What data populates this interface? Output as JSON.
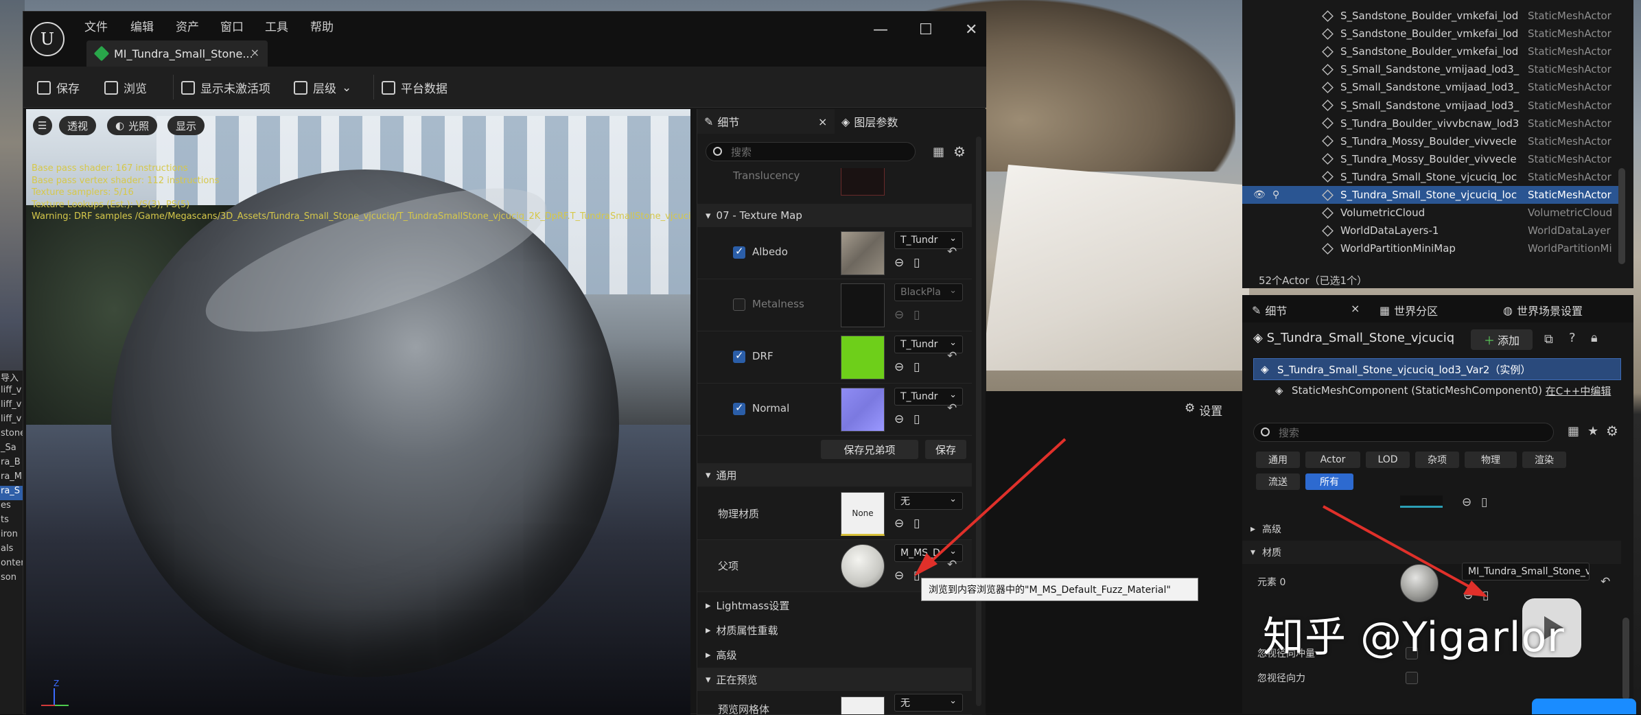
{
  "scene": {
    "left_partial_items": [
      "导入",
      "liff_v",
      "liff_v",
      "liff_v",
      "stone",
      "_Sa",
      "ra_B",
      "ra_M",
      "ra_S",
      "es",
      "ts",
      "iron",
      "als",
      "onten",
      "son"
    ],
    "left_selected_index": 8
  },
  "window": {
    "menu": [
      "文件",
      "编辑",
      "资产",
      "窗口",
      "工具",
      "帮助"
    ],
    "tab_title": "MI_Tundra_Small_Stone...",
    "tab_close": "×",
    "controls": {
      "minimize": "—",
      "maximize": "☐",
      "close": "✕"
    },
    "toolbar": {
      "save": "保存",
      "browse": "浏览",
      "show_inactive": "显示未激活项",
      "hierarchy": "层级",
      "platform": "平台数据"
    }
  },
  "viewport": {
    "buttons": {
      "menu": "☰",
      "perspective": "透视",
      "lit": "光照",
      "show": "显示"
    },
    "stats": [
      "Base pass shader: 167 instructions",
      "Base pass vertex shader: 112 instructions",
      "Texture samplers: 5/16",
      "Texture Lookups (Est.): VS(3), PS(5)",
      "Warning: DRF samples /Game/Megascans/3D_Assets/Tundra_Small_Stone_vjcuciq/T_TundraSmallStone_vjcuciq_2K_DpRF.T_TundraSmallStone_vjcuciq"
    ],
    "gizmo": {
      "x": "X",
      "y": "Y",
      "z": "Z"
    }
  },
  "details": {
    "tab_details": "细节",
    "tab_close": "×",
    "tab_layers": "图层参数",
    "search_placeholder": "搜索",
    "partial_label": "Translucency",
    "section_texture": "07 - Texture Map",
    "params": [
      {
        "label": "Albedo",
        "checked": true,
        "value": "T_Tundr",
        "color": "#8c8478"
      },
      {
        "label": "Metalness",
        "checked": false,
        "value": "BlackPla",
        "color": "#121212"
      },
      {
        "label": "DRF",
        "checked": true,
        "value": "T_Tundr",
        "color": "#6ecf1a"
      },
      {
        "label": "Normal",
        "checked": true,
        "value": "T_Tundr",
        "color": "#8a88f0"
      }
    ],
    "save_siblings": "保存兄弟项",
    "save_partial": "保存",
    "section_general": "通用",
    "phys_mat_label": "物理材质",
    "phys_mat_thumb": "None",
    "phys_mat_value": "无",
    "parent_label": "父项",
    "parent_value": "M_MS_D",
    "lightmass": "Lightmass设置",
    "mat_override": "材质属性重载",
    "advanced": "高级",
    "previewing": "正在预览",
    "preview_mesh_label": "预览网格体",
    "preview_mesh_thumb": "None",
    "preview_mesh_value": "无",
    "tooltip": "浏览到内容浏览器中的\"M_MS_Default_Fuzz_Material\"",
    "settings": "设置"
  },
  "outliner": {
    "rows": [
      {
        "name": "S_Sandstone_Boulder_vmkefai_lod",
        "type": "StaticMeshActor"
      },
      {
        "name": "S_Sandstone_Boulder_vmkefai_lod",
        "type": "StaticMeshActor"
      },
      {
        "name": "S_Sandstone_Boulder_vmkefai_lod",
        "type": "StaticMeshActor"
      },
      {
        "name": "S_Small_Sandstone_vmijaad_lod3_",
        "type": "StaticMeshActor"
      },
      {
        "name": "S_Small_Sandstone_vmijaad_lod3_",
        "type": "StaticMeshActor"
      },
      {
        "name": "S_Small_Sandstone_vmijaad_lod3_",
        "type": "StaticMeshActor"
      },
      {
        "name": "S_Tundra_Boulder_vivvbcnaw_lod3",
        "type": "StaticMeshActor"
      },
      {
        "name": "S_Tundra_Mossy_Boulder_vivvecle",
        "type": "StaticMeshActor"
      },
      {
        "name": "S_Tundra_Mossy_Boulder_vivvecle",
        "type": "StaticMeshActor"
      },
      {
        "name": "S_Tundra_Small_Stone_vjcuciq_loc",
        "type": "StaticMeshActor"
      },
      {
        "name": "S_Tundra_Small_Stone_vjcuciq_loc",
        "type": "StaticMeshActor"
      },
      {
        "name": "VolumetricCloud",
        "type": "VolumetricCloud"
      },
      {
        "name": "WorldDataLayers-1",
        "type": "WorldDataLayer"
      },
      {
        "name": "WorldPartitionMiniMap",
        "type": "WorldPartitionMi"
      }
    ],
    "selected_index": 10,
    "count": "52个Actor（已选1个）"
  },
  "rdetails": {
    "tab_details": "细节",
    "tab_close": "×",
    "tab_world": "世界分区",
    "tab_settings": "世界场景设置",
    "object_name": "S_Tundra_Small_Stone_vjcuciq",
    "add": "添加",
    "instance": "S_Tundra_Small_Stone_vjcuciq_lod3_Var2（实例）",
    "component": "StaticMeshComponent (StaticMeshComponent0)",
    "component_link": "在C++中编辑",
    "search_placeholder": "搜索",
    "filters": [
      "通用",
      "Actor",
      "LOD",
      "杂项",
      "物理",
      "渲染",
      "流送",
      "所有"
    ],
    "active_filter": "所有",
    "advanced": "高级",
    "materials": "材质",
    "element_label": "元素 0",
    "element_value": "MI_Tundra_Small_Stone_vjc",
    "ignore_impulse": "忽视径向冲量",
    "ignore_force": "忽视径向力"
  },
  "watermark": "知乎 @Yigarlor",
  "colors": {
    "accent": "#2d6ad0",
    "selection": "#2a5592",
    "arrow": "#e0302a"
  }
}
